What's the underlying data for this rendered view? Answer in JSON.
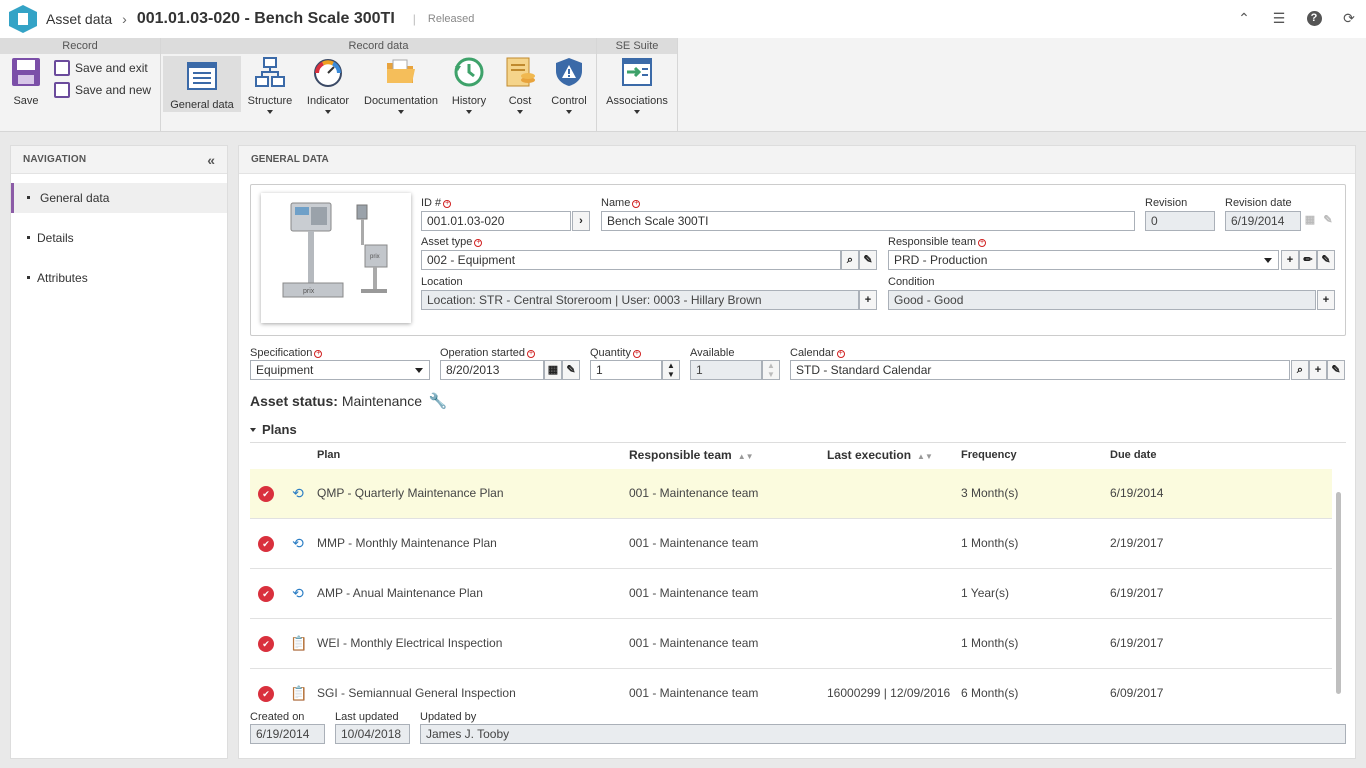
{
  "header": {
    "app_name": "Asset data",
    "record_title": "001.01.03-020 - Bench Scale 300TI",
    "status": "Released"
  },
  "ribbon": {
    "groups": {
      "record": "Record",
      "record_data": "Record data",
      "se_suite": "SE Suite"
    },
    "save": "Save",
    "save_and_exit": "Save and exit",
    "save_and_new": "Save and new",
    "general_data": "General data",
    "structure": "Structure",
    "indicator": "Indicator",
    "documentation": "Documentation",
    "history": "History",
    "cost": "Cost",
    "control": "Control",
    "associations": "Associations"
  },
  "nav": {
    "title": "NAVIGATION",
    "items": [
      {
        "label": "General data"
      },
      {
        "label": "Details"
      },
      {
        "label": "Attributes"
      }
    ]
  },
  "main": {
    "title": "GENERAL DATA"
  },
  "form": {
    "id_label": "ID #",
    "id_value": "001.01.03-020",
    "name_label": "Name",
    "name_value": "Bench Scale 300TI",
    "revision_label": "Revision",
    "revision_value": "0",
    "revision_date_label": "Revision date",
    "revision_date_value": "6/19/2014",
    "asset_type_label": "Asset type",
    "asset_type_value": "002 - Equipment",
    "responsible_team_label": "Responsible team",
    "responsible_team_value": "PRD - Production",
    "location_label": "Location",
    "location_value": "Location: STR - Central Storeroom | User: 0003 - Hillary Brown",
    "condition_label": "Condition",
    "condition_value": "Good - Good",
    "specification_label": "Specification",
    "specification_value": "Equipment",
    "operation_started_label": "Operation started",
    "operation_started_value": "8/20/2013",
    "quantity_label": "Quantity",
    "quantity_value": "1",
    "available_label": "Available",
    "available_value": "1",
    "calendar_label": "Calendar",
    "calendar_value": "STD - Standard Calendar"
  },
  "asset_status": {
    "label": "Asset status:",
    "value": "Maintenance"
  },
  "plans": {
    "title": "Plans",
    "columns": {
      "plan": "Plan",
      "responsible_team": "Responsible team",
      "last_execution": "Last execution",
      "frequency": "Frequency",
      "due_date": "Due date"
    },
    "rows": [
      {
        "type": "maintenance",
        "plan": "QMP - Quarterly Maintenance Plan",
        "team": "001 - Maintenance team",
        "last_execution": "",
        "frequency": "3 Month(s)",
        "due_date": "6/19/2014"
      },
      {
        "type": "maintenance",
        "plan": "MMP - Monthly Maintenance Plan",
        "team": "001 - Maintenance team",
        "last_execution": "",
        "frequency": "1 Month(s)",
        "due_date": "2/19/2017"
      },
      {
        "type": "maintenance",
        "plan": "AMP - Anual Maintenance Plan",
        "team": "001 - Maintenance team",
        "last_execution": "",
        "frequency": "1 Year(s)",
        "due_date": "6/19/2017"
      },
      {
        "type": "inspection",
        "plan": "WEI - Monthly Electrical Inspection",
        "team": "001 - Maintenance team",
        "last_execution": "",
        "frequency": "1 Month(s)",
        "due_date": "6/19/2017"
      },
      {
        "type": "inspection",
        "plan": "SGI - Semiannual General Inspection",
        "team": "001 - Maintenance team",
        "last_execution": "16000299 | 12/09/2016",
        "frequency": "6 Month(s)",
        "due_date": "6/09/2017"
      }
    ]
  },
  "footer": {
    "created_on_label": "Created on",
    "created_on_value": "6/19/2014",
    "last_updated_label": "Last updated",
    "last_updated_value": "10/04/2018",
    "updated_by_label": "Updated by",
    "updated_by_value": "James J. Tooby"
  },
  "colors": {
    "accent": "#8c5ca7",
    "highlight_row": "#fbfbde",
    "remove_icon": "#d9303d",
    "link_icon": "#2a7dc4"
  }
}
